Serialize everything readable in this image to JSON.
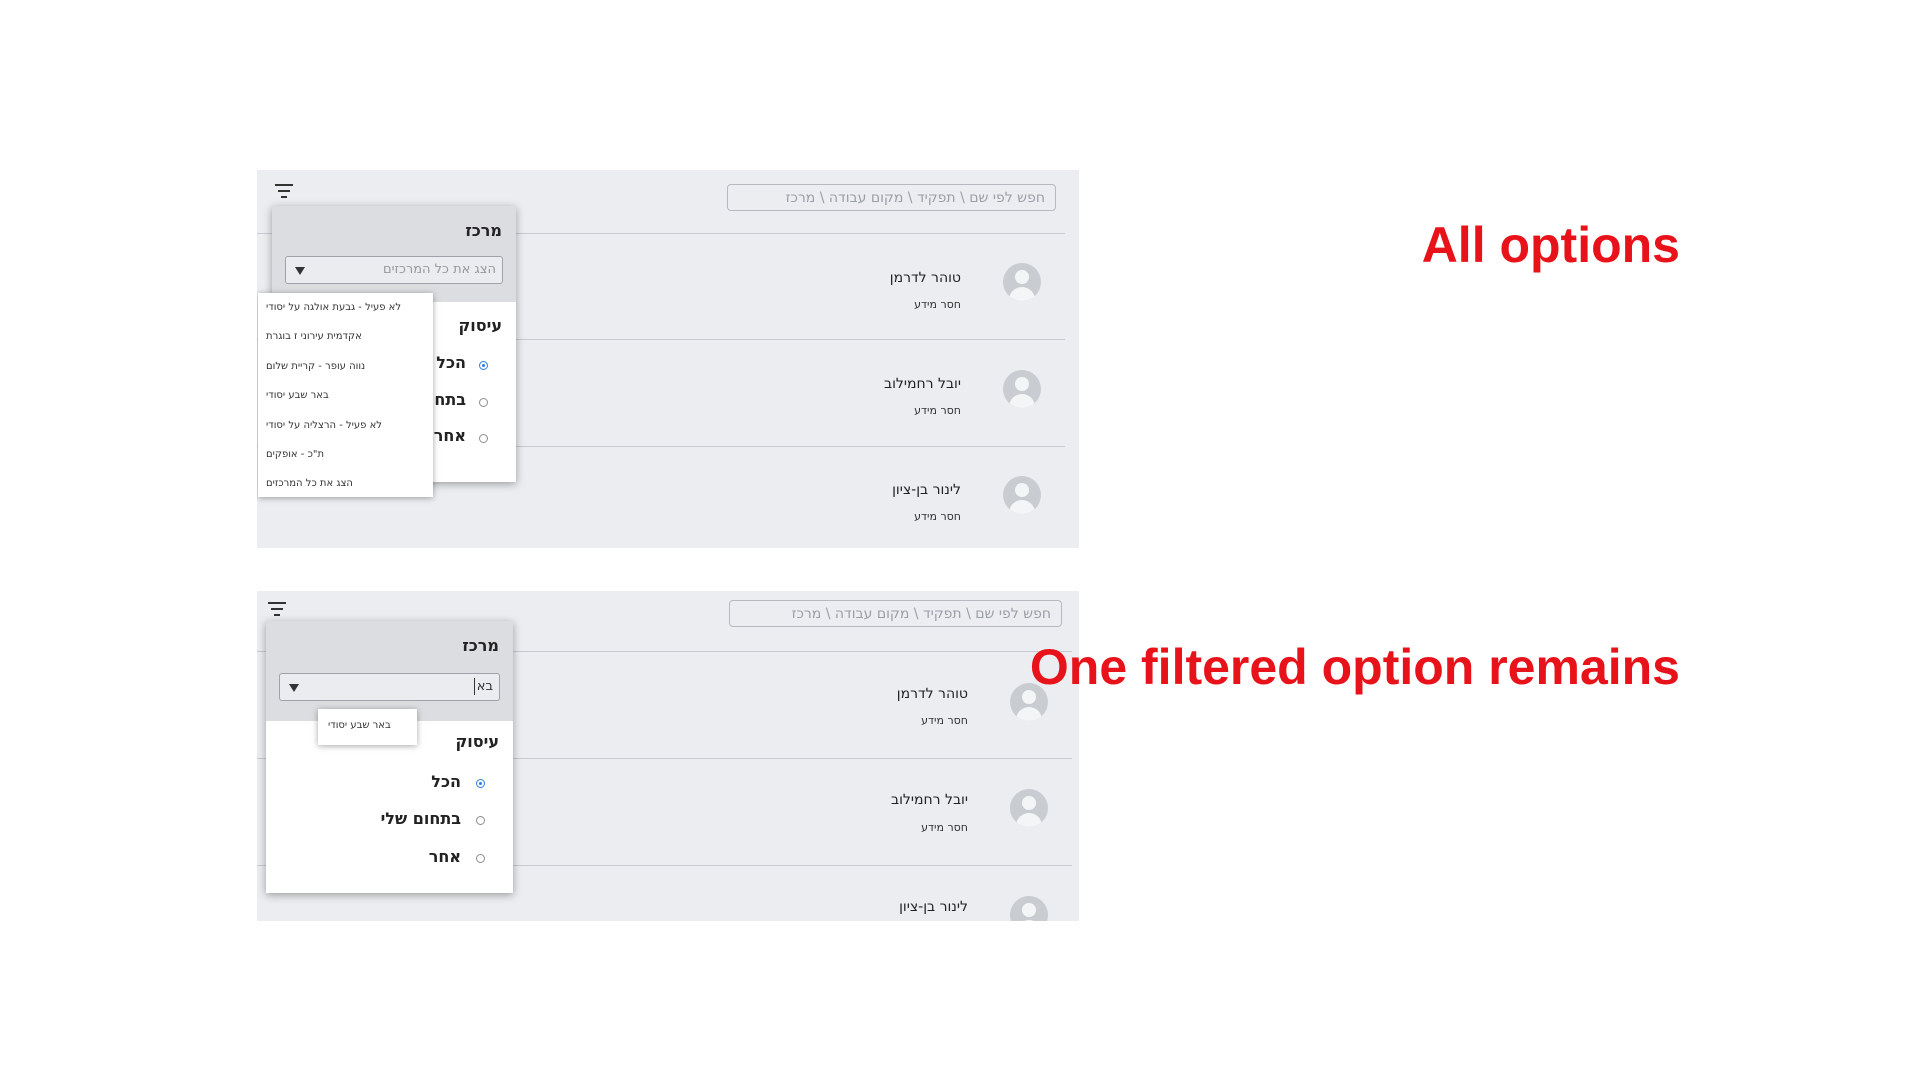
{
  "search": {
    "placeholder": "חפש לפי שם \\ תפקיד \\ מקום עבודה \\ מרכז"
  },
  "people": [
    {
      "name": "טוהר לדרמן",
      "status": "חסר מידע"
    },
    {
      "name": "יובל רחמילוב",
      "status": "חסר מידע"
    },
    {
      "name": "לינור בן-ציון",
      "status": "חסר מידע"
    }
  ],
  "filter": {
    "center_title": "מרכז",
    "select_placeholder": "הצג את כל המרכזים",
    "typed_value": "בא",
    "occupation_title": "עיסוק",
    "options": [
      "הכל",
      "בתחום שלי",
      "אחר"
    ],
    "selected_option": "הכל"
  },
  "dropdown_options_all": [
    "לא פעיל - גבעת אולגה על יסודי",
    "אקדמית עירוני ז בוגרת",
    "נווה עופר - קריית שלום",
    "באר שבע יסודי",
    "לא פעיל - הרצליה על יסודי",
    "ת\"כ - אופקים",
    "הצג את כל המרכזים"
  ],
  "dropdown_options_filtered": [
    "באר שבע יסודי"
  ],
  "annotations": {
    "all_options": "All options",
    "filtered": "One filtered option remains"
  },
  "colors": {
    "callout": "#e8131a",
    "radio_selected": "#2f7de1",
    "panel_bg": "#ebedf1"
  }
}
